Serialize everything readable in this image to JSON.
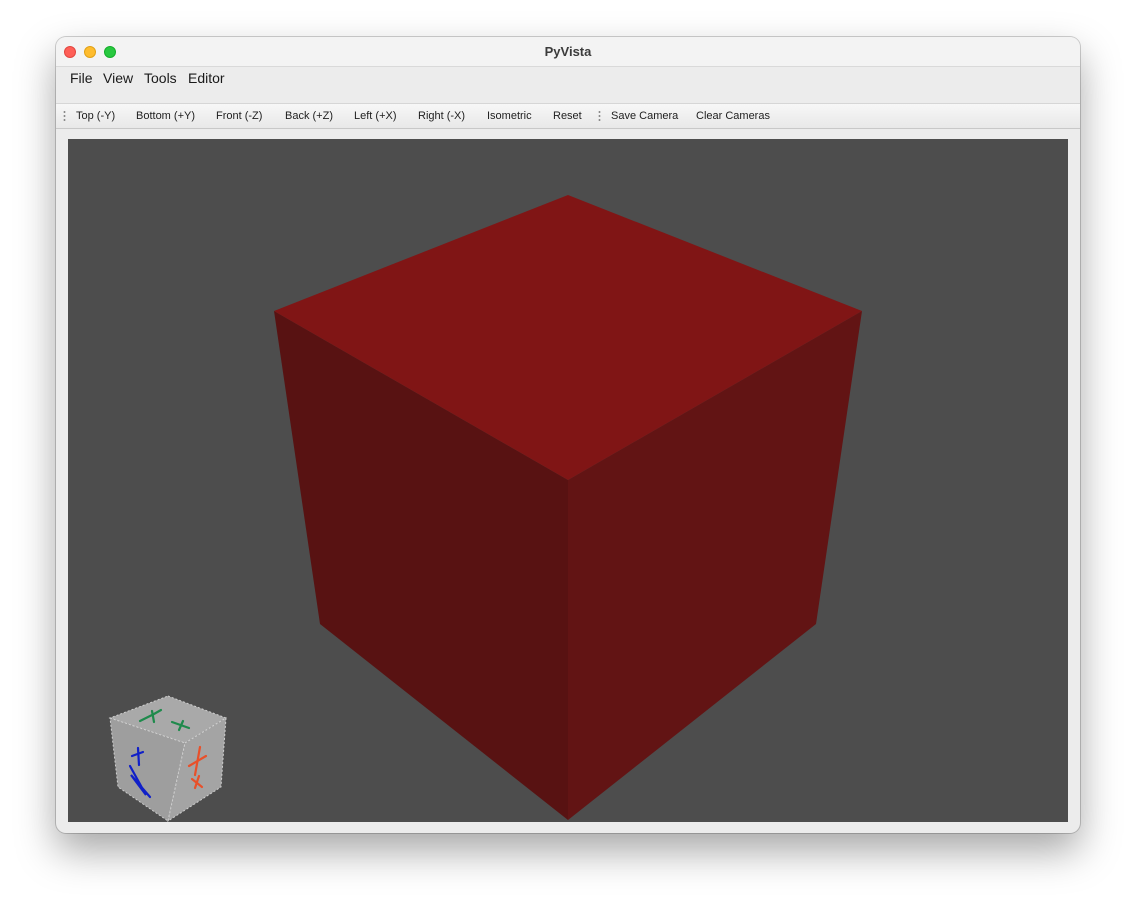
{
  "window": {
    "title": "PyVista"
  },
  "menubar": {
    "items": [
      "File",
      "View",
      "Tools",
      "Editor"
    ]
  },
  "toolbar": {
    "buttons": [
      "Top (-Y)",
      "Bottom (+Y)",
      "Front (-Z)",
      "Back (+Z)",
      "Left (+X)",
      "Right (-X)",
      "Isometric",
      "Reset",
      "Save Camera",
      "Clear Cameras"
    ]
  },
  "viewport": {
    "background_color": "#4d4d4d",
    "mesh_color": "#7f1515",
    "orientation_cube": {
      "face_labels": [
        "+Y",
        "+Z",
        "+X"
      ],
      "colors": {
        "x": "#e8502a",
        "y": "#1f8a4c",
        "z": "#1020c8",
        "face": "#a7a7a7"
      }
    }
  }
}
